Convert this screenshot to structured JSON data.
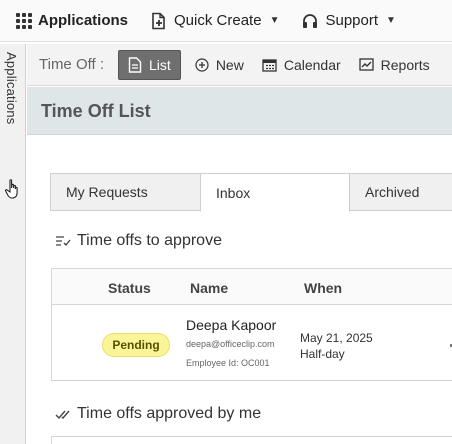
{
  "topbar": {
    "applications_label": "Applications",
    "quick_create_label": "Quick Create",
    "support_label": "Support",
    "caret_glyph": "▼"
  },
  "sidebar": {
    "applications_tab_label": "Applications"
  },
  "toolbar": {
    "module_label": "Time Off :",
    "buttons": [
      {
        "label": "List",
        "icon": "document-icon",
        "active": true
      },
      {
        "label": "New",
        "icon": "plus-circle-icon",
        "active": false
      },
      {
        "label": "Calendar",
        "icon": "calendar-icon",
        "active": false
      },
      {
        "label": "Reports",
        "icon": "chart-icon",
        "active": false
      }
    ]
  },
  "page": {
    "title": "Time Off List"
  },
  "tabs": [
    {
      "label": "My Requests",
      "active": false
    },
    {
      "label": "Inbox",
      "active": true
    },
    {
      "label": "Archived",
      "active": false
    }
  ],
  "sections": {
    "to_approve": "Time offs to approve",
    "approved_by_me": "Time offs approved by me"
  },
  "table": {
    "headers": {
      "status": "Status",
      "name": "Name",
      "when": "When"
    },
    "rows": [
      {
        "status": "Pending",
        "name": "Deepa Kapoor",
        "email": "deepa@officeclip.com",
        "employee_id": "Employee Id: OC001",
        "date": "May 21, 2025",
        "duration": "Half-day"
      }
    ]
  },
  "colors": {
    "pending_badge": "#fbf59a",
    "title_band": "#dfe6e7",
    "active_toolbar_button": "#6f6f6f"
  }
}
